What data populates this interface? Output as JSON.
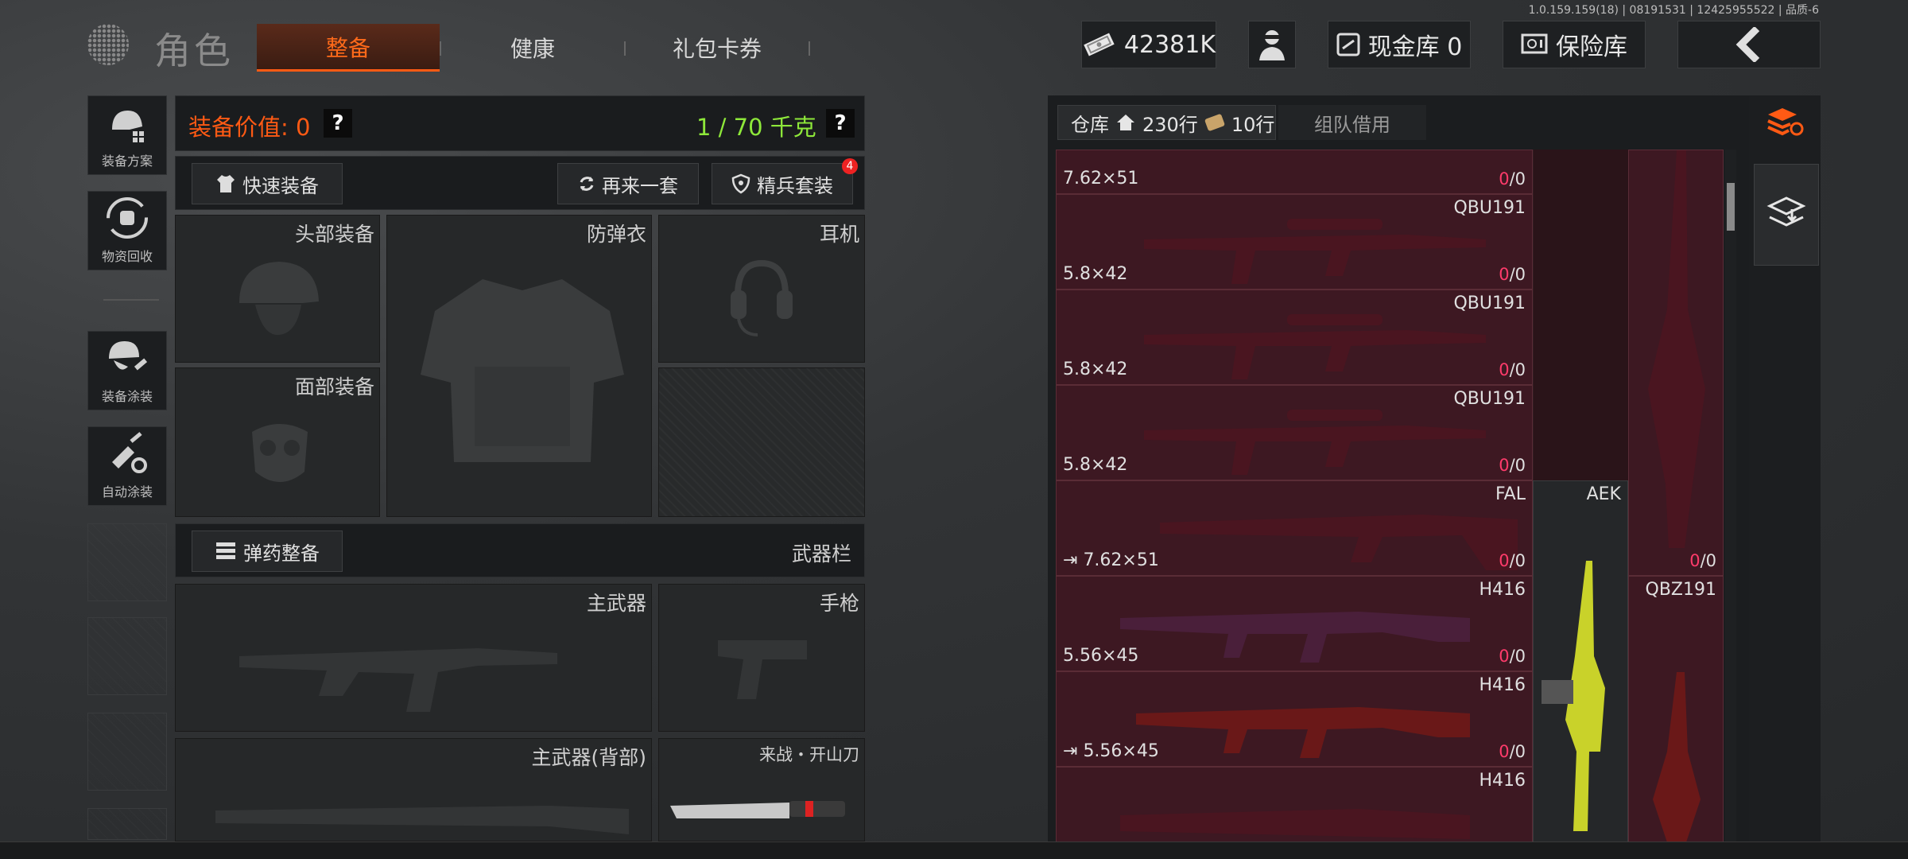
{
  "version_text": "1.0.159.159(18) | 08191531 | 12425955522 | 品质-6",
  "header": {
    "title": "角色",
    "tabs": [
      {
        "label": "整备"
      },
      {
        "label": "健康"
      },
      {
        "label": "礼包卡券"
      }
    ],
    "currency": "42381K",
    "cash_vault": "现金库 0",
    "insurance": "保险库"
  },
  "sidebar": {
    "items": [
      {
        "label": "装备方案"
      },
      {
        "label": "物资回收"
      },
      {
        "label": "装备涂装"
      },
      {
        "label": "自动涂装"
      }
    ]
  },
  "loadout": {
    "value_label": "装备价值: 0",
    "weight": "1 / 70 千克",
    "quick_equip": "快速装备",
    "again": "再来一套",
    "elite": "精兵套装",
    "elite_badge": "4",
    "slots": {
      "head": "头部装备",
      "armor": "防弹衣",
      "earphone": "耳机",
      "face": "面部装备"
    },
    "ammo_btn": "弹药整备",
    "weapon_bar": "武器栏",
    "weapons": {
      "primary": "主武器",
      "pistol": "手枪",
      "primary_back": "主武器(背部)",
      "melee": "来战・开山刀"
    }
  },
  "inventory": {
    "tab_warehouse": "仓库",
    "rows1": "230行",
    "rows2": "10行",
    "tab_team": "组队借用",
    "items": [
      {
        "name": "",
        "cal": "7.62×51",
        "ammo_a": "0",
        "ammo_b": "/0"
      },
      {
        "name": "QBU191",
        "cal": "5.8×42",
        "ammo_a": "0",
        "ammo_b": "/0"
      },
      {
        "name": "QBU191",
        "cal": "5.8×42",
        "ammo_a": "0",
        "ammo_b": "/0"
      },
      {
        "name": "QBU191",
        "cal": "5.8×42",
        "ammo_a": "0",
        "ammo_b": "/0"
      },
      {
        "name": "FAL",
        "cal": "7.62×51",
        "ammo_a": "0",
        "ammo_b": "/0"
      },
      {
        "name": "H416",
        "cal": "5.56×45",
        "ammo_a": "0",
        "ammo_b": "/0"
      },
      {
        "name": "H416",
        "cal": "5.56×45",
        "ammo_a": "0",
        "ammo_b": "/0"
      },
      {
        "name": "H416",
        "cal": "",
        "ammo_a": "",
        "ammo_b": ""
      }
    ],
    "aek": "AEK",
    "qbz": "QBZ191",
    "right_ammo_a": "0",
    "right_ammo_b": "/0"
  },
  "colors": {
    "accent": "#ff5a14",
    "weight_ok": "#8ee83a",
    "ammo": "#ff3b6b"
  }
}
